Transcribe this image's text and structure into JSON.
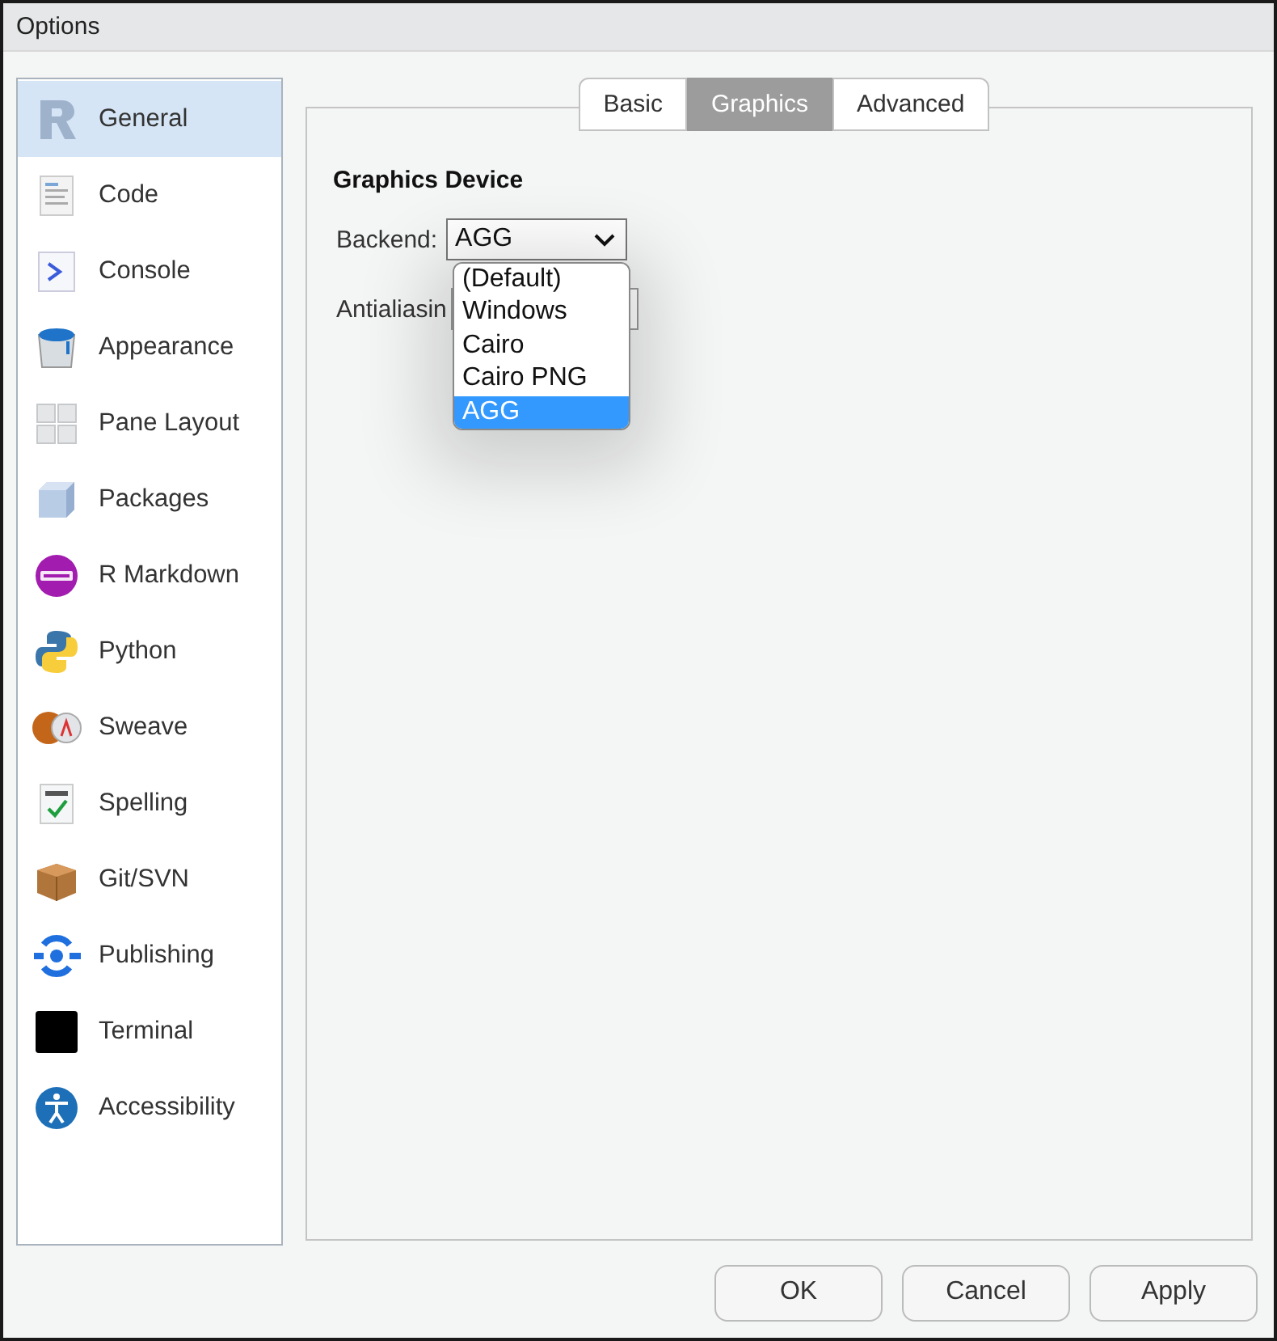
{
  "window": {
    "title": "Options"
  },
  "sidebar": {
    "items": [
      {
        "label": "General",
        "selected": true
      },
      {
        "label": "Code",
        "selected": false
      },
      {
        "label": "Console",
        "selected": false
      },
      {
        "label": "Appearance",
        "selected": false
      },
      {
        "label": "Pane Layout",
        "selected": false
      },
      {
        "label": "Packages",
        "selected": false
      },
      {
        "label": "R Markdown",
        "selected": false
      },
      {
        "label": "Python",
        "selected": false
      },
      {
        "label": "Sweave",
        "selected": false
      },
      {
        "label": "Spelling",
        "selected": false
      },
      {
        "label": "Git/SVN",
        "selected": false
      },
      {
        "label": "Publishing",
        "selected": false
      },
      {
        "label": "Terminal",
        "selected": false
      },
      {
        "label": "Accessibility",
        "selected": false
      }
    ]
  },
  "tabs": [
    {
      "label": "Basic",
      "selected": false
    },
    {
      "label": "Graphics",
      "selected": true
    },
    {
      "label": "Advanced",
      "selected": false
    }
  ],
  "section_title": "Graphics Device",
  "backend": {
    "label": "Backend:",
    "value": "AGG",
    "options": [
      {
        "label": "(Default)",
        "selected": false
      },
      {
        "label": "Windows",
        "selected": false
      },
      {
        "label": "Cairo",
        "selected": false
      },
      {
        "label": "Cairo PNG",
        "selected": false
      },
      {
        "label": "AGG",
        "selected": true
      }
    ]
  },
  "antialiasing": {
    "label": "Antialiasin"
  },
  "buttons": [
    "OK",
    "Cancel",
    "Apply"
  ]
}
